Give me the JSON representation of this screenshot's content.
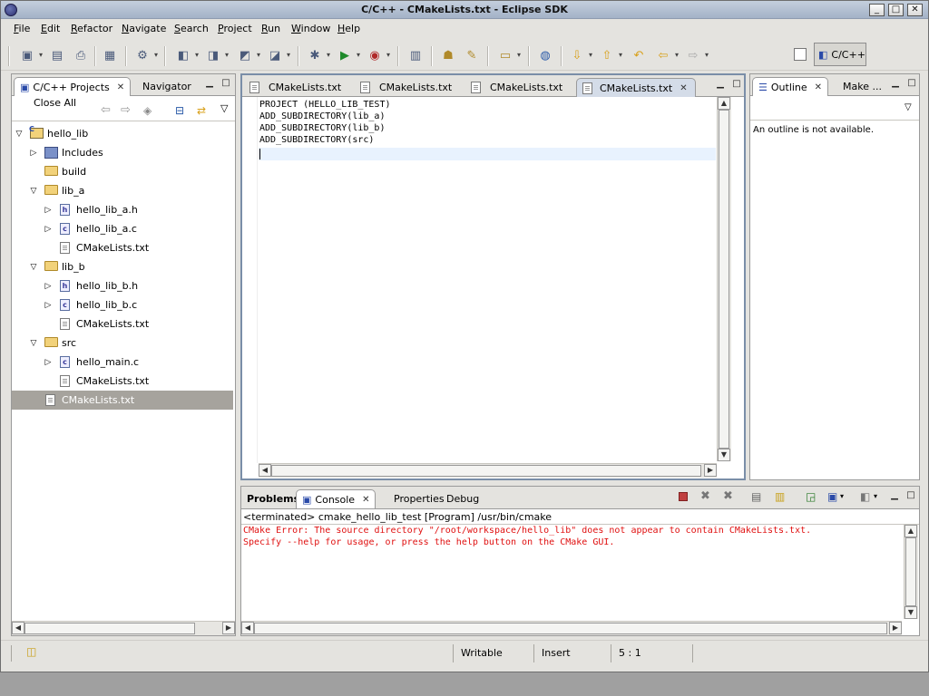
{
  "window": {
    "title": "C/C++ - CMakeLists.txt - Eclipse SDK",
    "controls": [
      "_",
      "□",
      "✕"
    ]
  },
  "menu": [
    "File",
    "Edit",
    "Refactor",
    "Navigate",
    "Search",
    "Project",
    "Run",
    "Window",
    "Help"
  ],
  "perspective": {
    "label": "C/C++"
  },
  "left_pane": {
    "tabs": [
      {
        "label": "C/C++ Projects",
        "active": true
      },
      {
        "label": "Navigator",
        "active": false
      }
    ],
    "toolbar": {
      "close_all": "Close All"
    },
    "tree": [
      {
        "label": "hello_lib",
        "icon": "project-icon",
        "expanded": true,
        "level": 0
      },
      {
        "label": "Includes",
        "icon": "includes-icon",
        "expanded": false,
        "level": 1
      },
      {
        "label": "build",
        "icon": "folder-icon",
        "level": 1
      },
      {
        "label": "lib_a",
        "icon": "folder-icon",
        "expanded": true,
        "level": 1
      },
      {
        "label": "hello_lib_a.h",
        "icon": "header-file-icon",
        "expanded": false,
        "level": 2
      },
      {
        "label": "hello_lib_a.c",
        "icon": "c-file-icon",
        "expanded": false,
        "level": 2
      },
      {
        "label": "CMakeLists.txt",
        "icon": "text-file-icon",
        "level": 2
      },
      {
        "label": "lib_b",
        "icon": "folder-icon",
        "expanded": true,
        "level": 1
      },
      {
        "label": "hello_lib_b.h",
        "icon": "header-file-icon",
        "expanded": false,
        "level": 2
      },
      {
        "label": "hello_lib_b.c",
        "icon": "c-file-icon",
        "expanded": false,
        "level": 2
      },
      {
        "label": "CMakeLists.txt",
        "icon": "text-file-icon",
        "level": 2
      },
      {
        "label": "src",
        "icon": "folder-icon",
        "expanded": true,
        "level": 1
      },
      {
        "label": "hello_main.c",
        "icon": "c-file-icon",
        "expanded": false,
        "level": 2
      },
      {
        "label": "CMakeLists.txt",
        "icon": "text-file-icon",
        "level": 2
      },
      {
        "label": "CMakeLists.txt",
        "icon": "text-file-icon",
        "level": 1,
        "selected": true
      }
    ]
  },
  "editor": {
    "tabs": [
      {
        "label": "CMakeLists.txt",
        "active": false
      },
      {
        "label": "CMakeLists.txt",
        "active": false
      },
      {
        "label": "CMakeLists.txt",
        "active": false
      },
      {
        "label": "CMakeLists.txt",
        "active": true
      }
    ],
    "lines": [
      "PROJECT (HELLO_LIB_TEST)",
      "ADD_SUBDIRECTORY(lib_a)",
      "ADD_SUBDIRECTORY(lib_b)",
      "ADD_SUBDIRECTORY(src)",
      ""
    ]
  },
  "right_pane": {
    "tabs": [
      {
        "label": "Outline",
        "active": true
      },
      {
        "label": "Make ...",
        "active": false
      }
    ],
    "message": "An outline is not available."
  },
  "bottom_pane": {
    "tabs": [
      {
        "label": "Problems",
        "active": false
      },
      {
        "label": "Console",
        "active": true
      },
      {
        "label": "Properties",
        "active": false
      },
      {
        "label": "Debug",
        "active": false
      }
    ],
    "process": "<terminated> cmake_hello_lib_test [Program] /usr/bin/cmake",
    "console_lines": [
      "CMake Error: The source directory \"/root/workspace/hello_lib\" does not appear to contain CMakeLists.txt.",
      "Specify --help for usage, or press the help button on the CMake GUI."
    ],
    "error_color": "#e01010"
  },
  "status": {
    "writable": "Writable",
    "insert_mode": "Insert",
    "position": "5 : 1"
  }
}
